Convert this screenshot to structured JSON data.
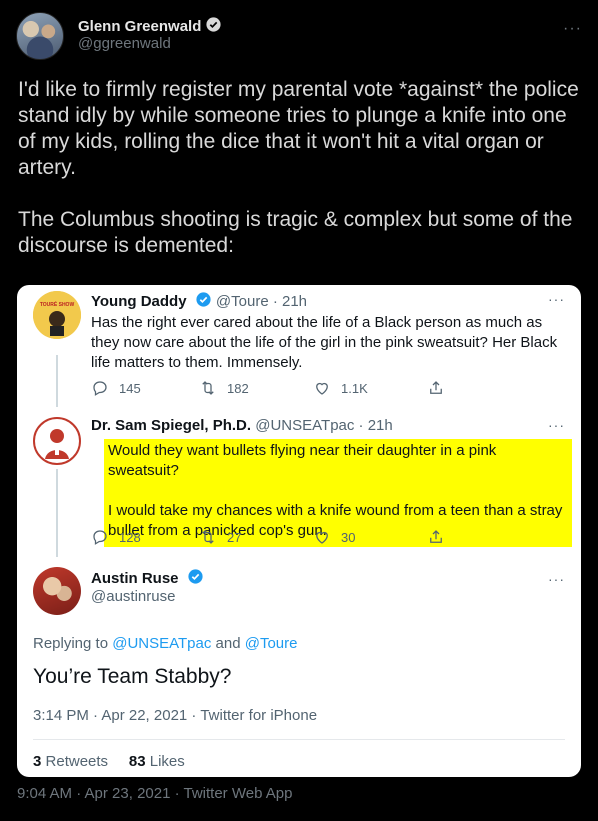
{
  "outer_tweet": {
    "name": "Glenn Greenwald",
    "handle": "@ggreenwald",
    "text_p1": "I'd like to firmly register my parental vote *against* the police stand idly by while someone tries to plunge a knife into one of my kids, rolling the dice that it won't hit a vital organ or artery.",
    "text_p2": "The Columbus shooting is tragic & complex but some of the discourse is demented:",
    "timestamp": "9:04 AM · Apr 23, 2021 · Twitter Web App"
  },
  "embedded": {
    "tweet1": {
      "name": "Young Daddy",
      "meta": "@Toure · 21h",
      "avatar_text": "TOURÉ SHOW",
      "text": "Has the right ever cared about the life of a Black person as much as they now care about the life of the girl in the pink sweatsuit? Her Black life matters to them. Immensely.",
      "replies": "145",
      "retweets": "182",
      "likes": "1.1K"
    },
    "tweet2": {
      "name": "Dr. Sam Spiegel, Ph.D.",
      "meta": "@UNSEATpac · 21h",
      "text_p1": "Would they want bullets flying near their daughter in a pink sweatsuit?",
      "text_p2": "I would take my chances with a knife wound from a teen than a stray bullet from a panicked cop's gun.",
      "replies": "128",
      "retweets": "27",
      "likes": "30"
    },
    "tweet3": {
      "name": "Austin Ruse",
      "handle": "@austinruse",
      "replying_prefix": "Replying to",
      "replying_user1": "@UNSEATpac",
      "replying_and": "and",
      "replying_user2": "@Toure",
      "text": "You’re Team Stabby?",
      "timestamp": "3:14 PM · Apr 22, 2021 · Twitter for iPhone",
      "retweets_count": "3",
      "retweets_label": "Retweets",
      "likes_count": "83",
      "likes_label": "Likes"
    }
  },
  "colors": {
    "background": "#000000",
    "verified": "#1d9bf0",
    "highlight": "#ffff00",
    "link": "#1d9bf0"
  },
  "icons": [
    "verified-badge-icon",
    "more-icon",
    "reply-icon",
    "retweet-icon",
    "like-icon",
    "share-icon"
  ]
}
